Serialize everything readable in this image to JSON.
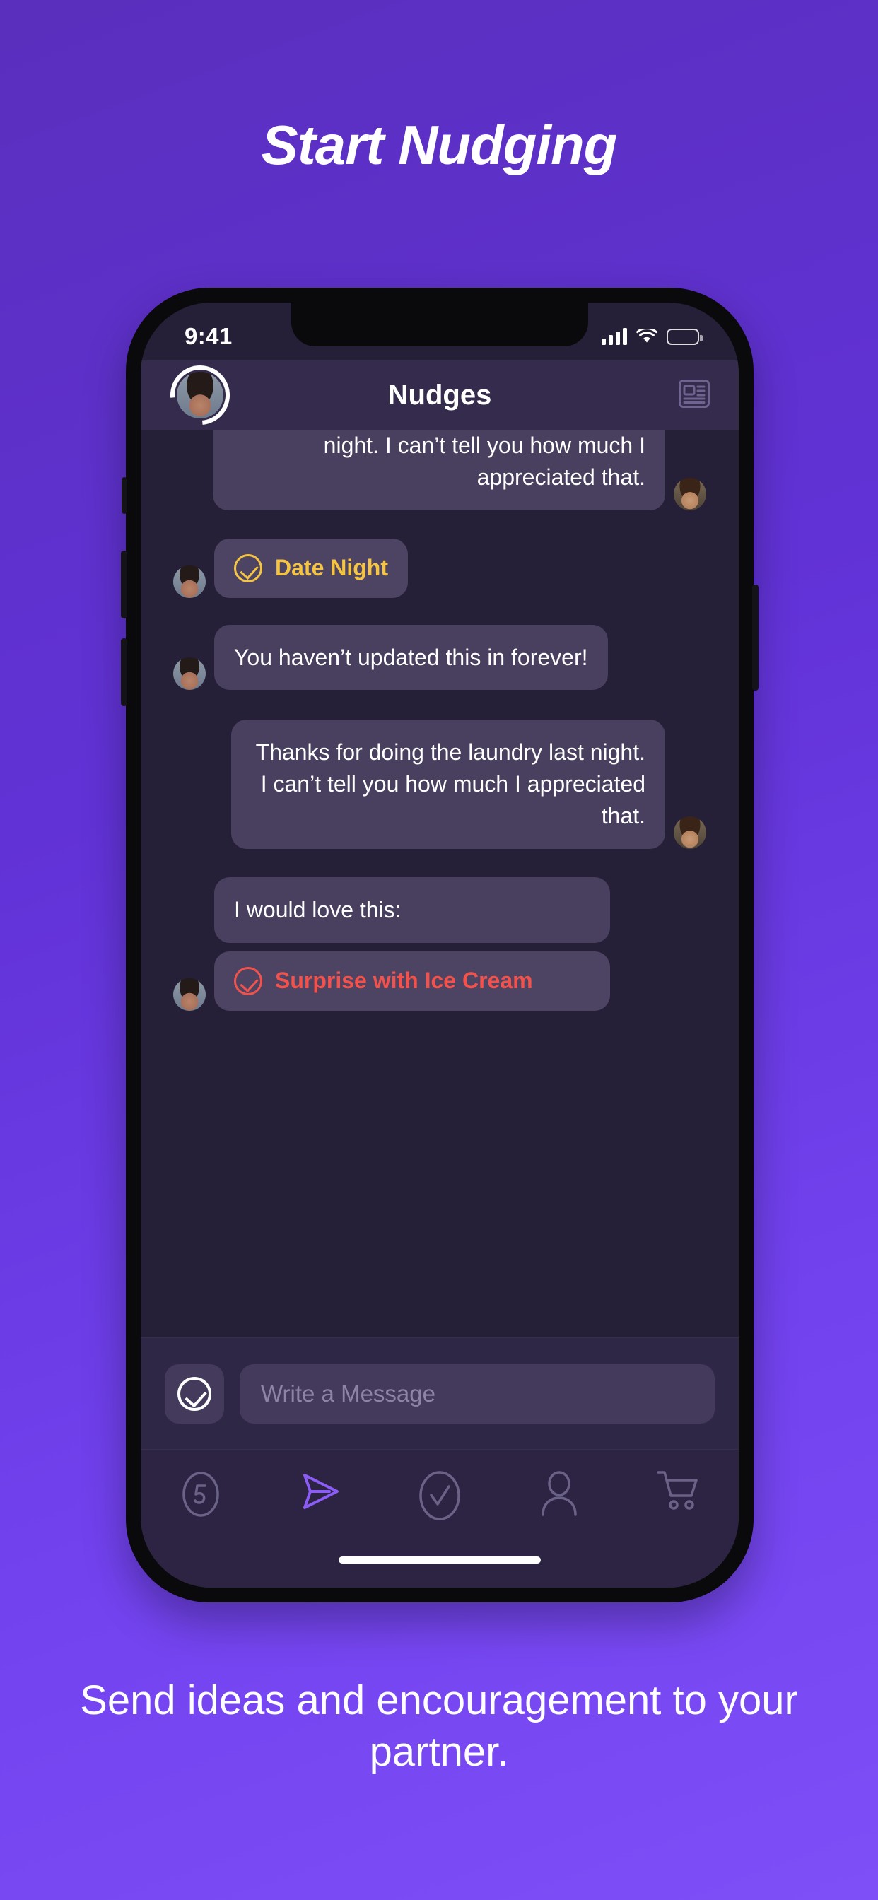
{
  "headline": "Start Nudging",
  "caption": "Send ideas and encouragement to your partner.",
  "colors": {
    "background_purple": "#6132d6",
    "screen_bg": "#251f37",
    "navbar_bg": "#352b4d",
    "bubble_bg": "#494060",
    "accent_purple": "#8b5cf6",
    "nudge_yellow": "#f5c542",
    "nudge_red": "#f2524b",
    "placeholder_text": "#8d85a3"
  },
  "phone": {
    "statusbar": {
      "time": "9:41",
      "signal_icon": "cellular-bars-icon",
      "wifi_icon": "wifi-icon",
      "battery_icon": "battery-full-icon"
    },
    "navbar": {
      "title": "Nudges",
      "avatar_name": "avatar",
      "right_icon": "article-icon"
    },
    "messages": [
      {
        "id": "m1",
        "type": "text",
        "direction": "out",
        "text": "night. I can’t tell you how much I appreciated that.",
        "clipped": true,
        "avatar": "warm"
      },
      {
        "id": "m2",
        "type": "nudge",
        "direction": "in",
        "text": "Date Night",
        "color": "#f5c542",
        "icon": "check-circle-icon",
        "avatar": "cool"
      },
      {
        "id": "m3",
        "type": "text",
        "direction": "in",
        "text": "You haven’t updated this in forever!",
        "avatar": "cool"
      },
      {
        "id": "m4",
        "type": "text",
        "direction": "out",
        "text": "Thanks for doing the laundry last night. I can’t tell you how much I appreciated that.",
        "avatar": "warm"
      },
      {
        "id": "m5",
        "type": "text",
        "direction": "in",
        "text": "I would love this:",
        "avatar": "none"
      },
      {
        "id": "m6",
        "type": "nudge",
        "direction": "in",
        "text": "Surprise with Ice Cream",
        "color": "#f2524b",
        "icon": "check-circle-icon",
        "avatar": "cool"
      }
    ],
    "composer": {
      "action_icon": "check-circle-icon",
      "placeholder": "Write a Message",
      "value": ""
    },
    "tabbar": {
      "items": [
        {
          "id": "countdown",
          "icon": "number-five-circle-icon",
          "label": "5",
          "active": false
        },
        {
          "id": "messages",
          "icon": "send-icon",
          "label": "",
          "active": true
        },
        {
          "id": "nudges",
          "icon": "check-circle-icon",
          "label": "",
          "active": false
        },
        {
          "id": "profile",
          "icon": "person-icon",
          "label": "",
          "active": false
        },
        {
          "id": "store",
          "icon": "cart-icon",
          "label": "",
          "active": false
        }
      ]
    }
  }
}
